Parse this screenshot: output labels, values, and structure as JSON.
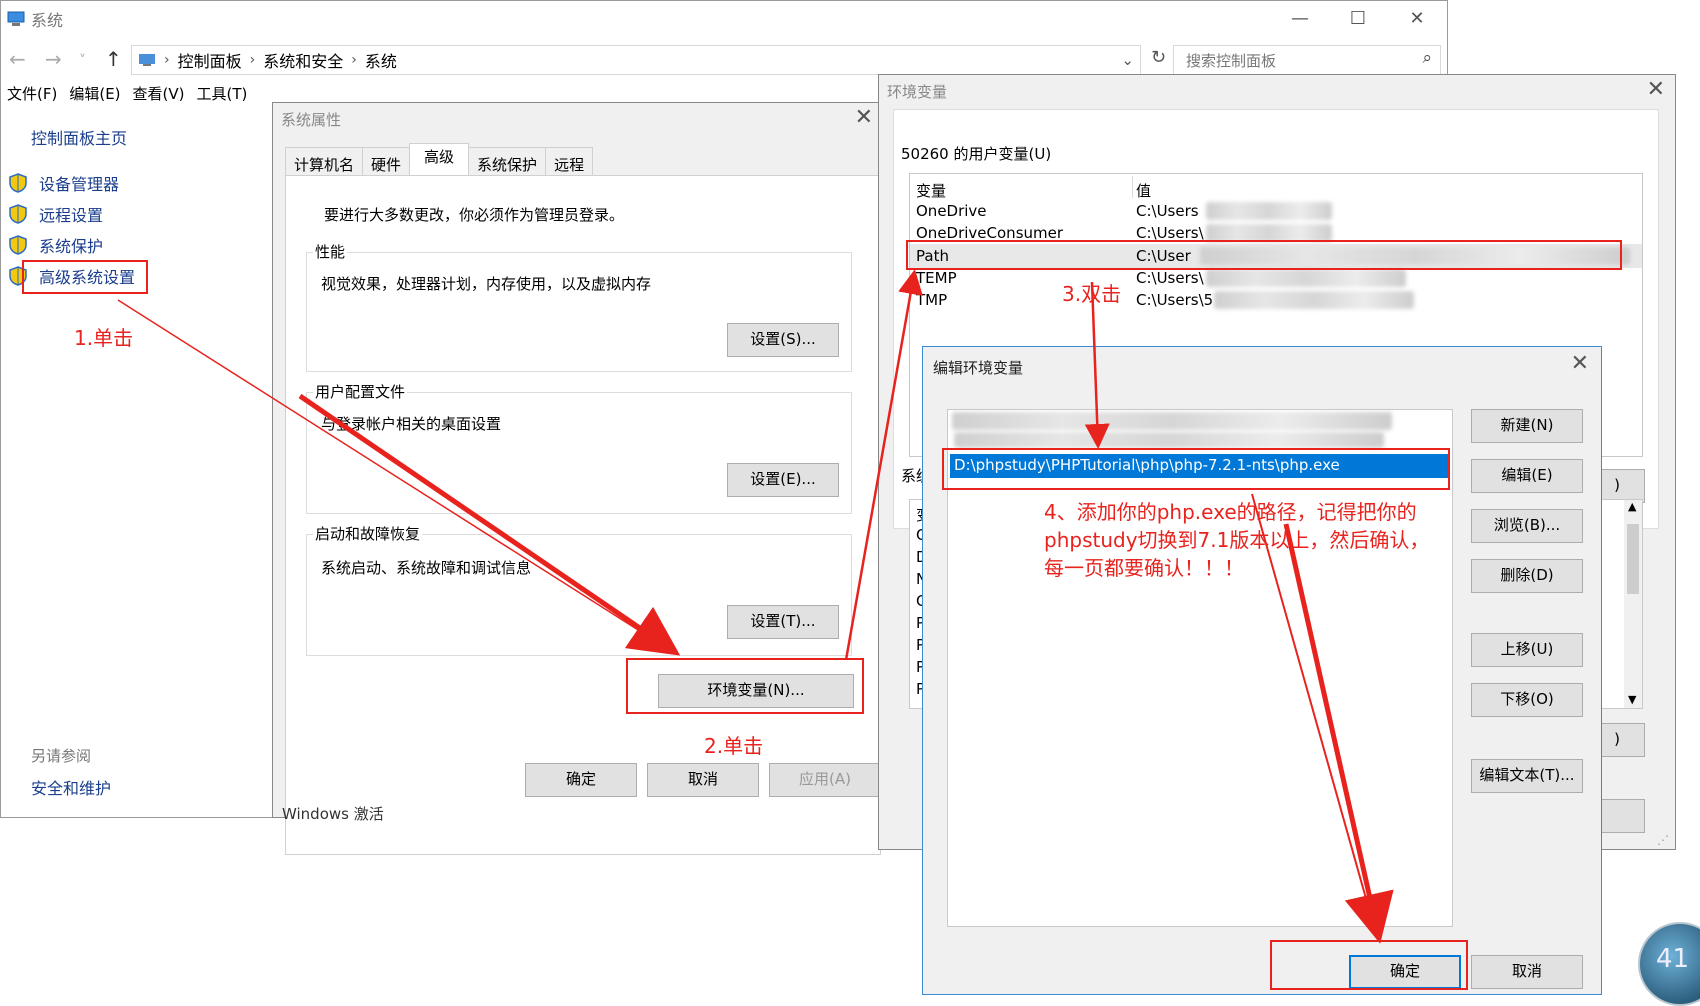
{
  "main_window": {
    "title": "系统",
    "minimize": "—",
    "maximize": "☐",
    "close": "✕",
    "breadcrumb": [
      "控制面板",
      "系统和安全",
      "系统"
    ],
    "search_placeholder": "搜索控制面板",
    "menu": [
      "文件(F)",
      "编辑(E)",
      "查看(V)",
      "工具(T)"
    ],
    "sidebar_home": "控制面板主页",
    "sidebar_items": [
      "设备管理器",
      "远程设置",
      "系统保护",
      "高级系统设置"
    ],
    "see_also": "另请参阅",
    "see_also_link": "安全和维护",
    "partial_footer": "Windows 激活"
  },
  "system_properties": {
    "title": "系统属性",
    "tabs": [
      "计算机名",
      "硬件",
      "高级",
      "系统保护",
      "远程"
    ],
    "admin_note": "要进行大多数更改，你必须作为管理员登录。",
    "performance": {
      "label": "性能",
      "desc": "视觉效果，处理器计划，内存使用，以及虚拟内存",
      "button": "设置(S)..."
    },
    "profiles": {
      "label": "用户配置文件",
      "desc": "与登录帐户相关的桌面设置",
      "button": "设置(E)..."
    },
    "startup": {
      "label": "启动和故障恢复",
      "desc": "系统启动、系统故障和调试信息",
      "button": "设置(T)..."
    },
    "env_button": "环境变量(N)...",
    "ok": "确定",
    "cancel": "取消",
    "apply": "应用(A)"
  },
  "env_vars": {
    "title": "环境变量",
    "user_section": "50260 的用户变量(U)",
    "col_var": "变量",
    "col_val": "值",
    "rows": [
      {
        "name": "OneDrive",
        "value": "C:\\Users"
      },
      {
        "name": "OneDriveConsumer",
        "value": "C:\\Users\\"
      },
      {
        "name": "Path",
        "value": "C:\\User"
      },
      {
        "name": "TEMP",
        "value": "C:\\Users\\"
      },
      {
        "name": "TMP",
        "value": "C:\\Users\\5"
      }
    ],
    "sys_section_partial": "系统",
    "sys_col_partial": "变",
    "sys_rows_partial": [
      "C",
      "D",
      "N",
      "C",
      "P",
      "P",
      "P",
      "P"
    ]
  },
  "edit_env": {
    "title": "编辑环境变量",
    "selected_entry": "D:\\phpstudy\\PHPTutorial\\php\\php-7.2.1-nts\\php.exe",
    "buttons": [
      "新建(N)",
      "编辑(E)",
      "浏览(B)...",
      "删除(D)",
      "上移(U)",
      "下移(O)",
      "编辑文本(T)..."
    ],
    "ok": "确定",
    "cancel": "取消"
  },
  "annotations": {
    "step1": "1.单击",
    "step2": "2.单击",
    "step3": "3.双击",
    "step4": "4、添加你的php.exe的路径，记得把你的phpstudy切换到7.1版本以上，然后确认，每一页都要确认！！！",
    "color": "#e8231e"
  },
  "tray_number": "41"
}
